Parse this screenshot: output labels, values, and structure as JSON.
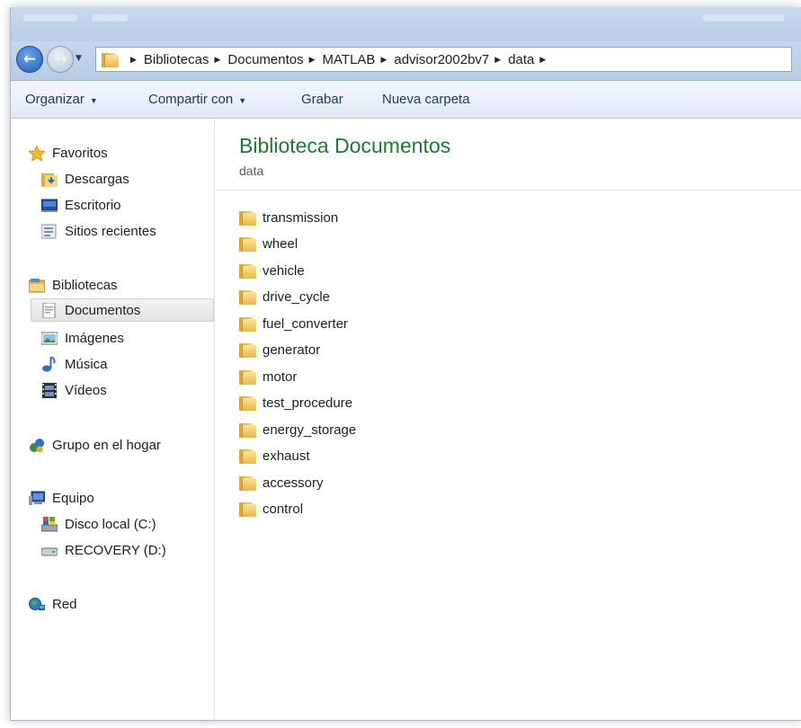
{
  "address": {
    "crumbs": [
      "Bibliotecas",
      "Documentos",
      "MATLAB",
      "advisor2002bv7",
      "data"
    ]
  },
  "toolbar": {
    "organize_label": "Organizar",
    "share_label": "Compartir con",
    "burn_label": "Grabar",
    "new_folder_label": "Nueva carpeta"
  },
  "nav": {
    "favorites": {
      "label": "Favoritos",
      "icon": "star-icon"
    },
    "favorites_items": [
      {
        "label": "Descargas",
        "icon": "downloads-folder-icon"
      },
      {
        "label": "Escritorio",
        "icon": "desktop-icon"
      },
      {
        "label": "Sitios recientes",
        "icon": "recent-places-icon"
      }
    ],
    "libraries": {
      "label": "Bibliotecas",
      "icon": "libraries-icon"
    },
    "libraries_items": [
      {
        "label": "Documentos",
        "icon": "documents-icon",
        "selected": true
      },
      {
        "label": "Imágenes",
        "icon": "pictures-icon"
      },
      {
        "label": "Música",
        "icon": "music-icon"
      },
      {
        "label": "Vídeos",
        "icon": "videos-icon"
      }
    ],
    "homegroup": {
      "label": "Grupo en el hogar",
      "icon": "homegroup-icon"
    },
    "computer": {
      "label": "Equipo",
      "icon": "computer-icon"
    },
    "computer_items": [
      {
        "label": "Disco local (C:)",
        "icon": "local-disk-icon"
      },
      {
        "label": "RECOVERY (D:)",
        "icon": "drive-icon"
      }
    ],
    "network": {
      "label": "Red",
      "icon": "network-icon"
    }
  },
  "library": {
    "title": "Biblioteca Documentos",
    "subtitle": "data"
  },
  "folders": [
    "transmission",
    "wheel",
    "vehicle",
    "drive_cycle",
    "fuel_converter",
    "generator",
    "motor",
    "test_procedure",
    "energy_storage",
    "exhaust",
    "accessory",
    "control"
  ],
  "colors": {
    "library_title": "#1e7a2f",
    "toolbar_text": "#1e395b",
    "selection": "#e6e6e6"
  }
}
